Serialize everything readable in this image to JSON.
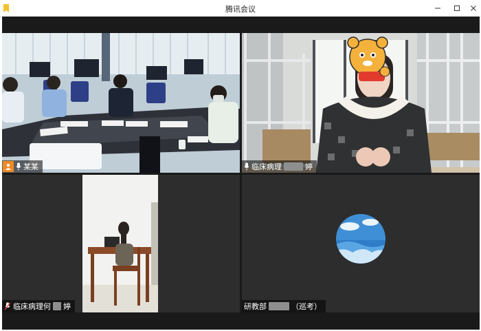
{
  "window": {
    "title": "腾讯会议",
    "controls": [
      "minimize-icon",
      "maximize-icon",
      "close-icon"
    ]
  },
  "participants": [
    {
      "id": "p1",
      "name": "某某",
      "host": true,
      "mic": "on",
      "speaking": true,
      "video": "meeting-room"
    },
    {
      "id": "p2",
      "name_prefix": "临床病理",
      "name_suffix": "婷",
      "name_masked": true,
      "mic": "on",
      "video": "dorm-student"
    },
    {
      "id": "p3",
      "name_prefix": "临床病理何",
      "name_suffix": "婷",
      "name_masked": true,
      "mic": "off",
      "video": "desk-student"
    },
    {
      "id": "p4",
      "name_prefix": "研教部",
      "name_suffix": "（巡考）",
      "name_masked": true,
      "mic": "none",
      "video": "off",
      "avatar": "sea-sky-avatar"
    }
  ],
  "colors": {
    "active_speaker_border": "#26c06a",
    "host_badge": "#f08a24",
    "tile_background": "#2b2b2b",
    "stage_background": "#1a1a1a"
  }
}
